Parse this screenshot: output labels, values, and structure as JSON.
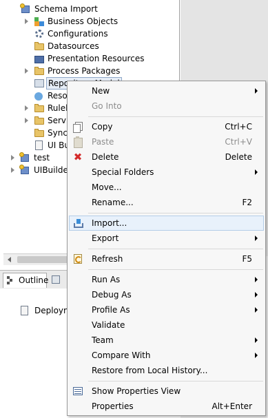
{
  "tree": {
    "root": "Schema Import",
    "items": [
      "Business Objects",
      "Configurations",
      "Datasources",
      "Presentation Resources",
      "Process Packages",
      "Repository Model",
      "Resources",
      "Rulebooks",
      "Services",
      "Sync",
      "UI Builder"
    ],
    "visible_labels": {
      "repository": "Repository Model",
      "resources": "Resou",
      "rulebooks": "Ruleb",
      "services": "Servic",
      "sync": "Sync",
      "uibuilder": "UI Bu"
    },
    "projects": [
      "test",
      "UIBuilder"
    ]
  },
  "outline": {
    "tab_label": "Outline",
    "item": "Deploym"
  },
  "context_menu": {
    "new": "New",
    "go_into": "Go Into",
    "copy": "Copy",
    "copy_shortcut": "Ctrl+C",
    "paste": "Paste",
    "paste_shortcut": "Ctrl+V",
    "delete": "Delete",
    "delete_shortcut": "Delete",
    "special_folders": "Special Folders",
    "move": "Move...",
    "rename": "Rename...",
    "rename_shortcut": "F2",
    "import": "Import...",
    "export": "Export",
    "refresh": "Refresh",
    "refresh_shortcut": "F5",
    "run_as": "Run As",
    "debug_as": "Debug As",
    "profile_as": "Profile As",
    "validate": "Validate",
    "team": "Team",
    "compare_with": "Compare With",
    "restore": "Restore from Local History...",
    "show_properties": "Show Properties View",
    "properties": "Properties",
    "properties_shortcut": "Alt+Enter"
  },
  "colors": {
    "menu_bg": "#f7f7f7",
    "highlight_bg": "#e8f1fb",
    "highlight_border": "#b3cde8",
    "disabled_text": "#8d8d8d",
    "folder_yellow": "#e8c468"
  }
}
